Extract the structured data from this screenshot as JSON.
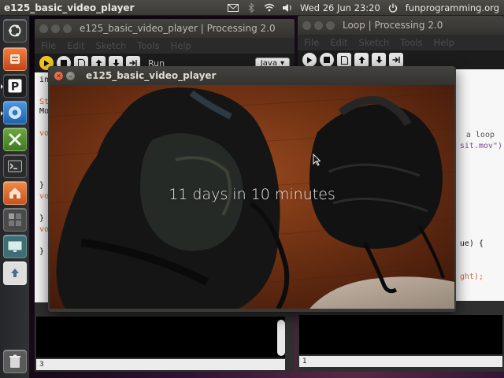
{
  "top_panel": {
    "app_title": "e125_basic_video_player",
    "clock": "Wed 26 Jun 23:20",
    "user": "funprogramming.org",
    "icons": [
      "mail-icon",
      "bluetooth-icon",
      "wifi-icon",
      "volume-icon",
      "power-icon"
    ]
  },
  "launcher": {
    "items": [
      {
        "name": "ubuntu-home-icon",
        "glyph": "◎",
        "color": "#3c3c3c"
      },
      {
        "name": "sublime-icon",
        "glyph": "S",
        "color": "#d35a1e"
      },
      {
        "name": "processing-icon",
        "glyph": "P",
        "color": "#1f1f1f"
      },
      {
        "name": "chromium-icon",
        "glyph": "◉",
        "color": "#2f78c8"
      },
      {
        "name": "cross-tool-icon",
        "glyph": "✕",
        "color": "#4c8c2c"
      },
      {
        "name": "terminal-icon",
        "glyph": ">_",
        "color": "#2b2b2b"
      },
      {
        "name": "home-folder-icon",
        "glyph": "⌂",
        "color": "#d8622a"
      },
      {
        "name": "workspace-switcher-icon",
        "glyph": "▦",
        "color": "#555555"
      },
      {
        "name": "monitor-icon",
        "glyph": "▭",
        "color": "#3b6f73"
      },
      {
        "name": "upload-icon",
        "glyph": "▲",
        "color": "#c9c9c9"
      },
      {
        "name": "trash-icon",
        "glyph": "🗑",
        "color": "#6a6a6a"
      }
    ]
  },
  "editor_left": {
    "title": "e125_basic_video_player | Processing 2.0",
    "menus": [
      "File",
      "Edit",
      "Sketch",
      "Tools",
      "Help"
    ],
    "run_label": "Run",
    "mode": "Java",
    "code_fragments": [
      "in",
      "St",
      "Mo",
      "vo",
      "}",
      "vo",
      "}",
      "vo",
      "}"
    ],
    "status_line": "3"
  },
  "editor_right": {
    "title": "Loop | Processing 2.0",
    "menus": [
      "File",
      "Edit",
      "Sketch",
      "Tools",
      "Help"
    ],
    "code_fragments": [
      "a loop",
      "sit.mov\")",
      "ue) {",
      "ght);"
    ],
    "status_line": "1"
  },
  "player": {
    "title": "e125_basic_video_player",
    "overlay": "11 days in 10 minutes"
  }
}
